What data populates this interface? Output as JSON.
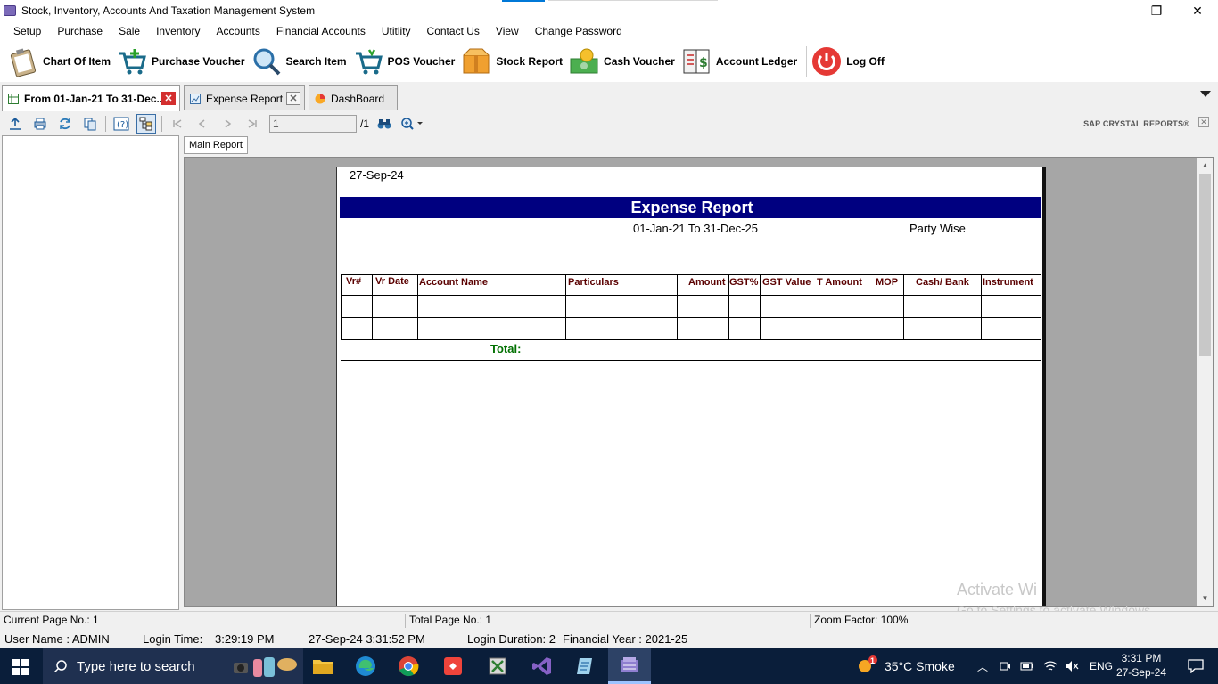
{
  "window": {
    "title": "Stock, Inventory, Accounts And Taxation Management System",
    "controls": {
      "minimize": "—",
      "restore": "❐",
      "close": "✕"
    }
  },
  "menu": [
    "Setup",
    "Purchase",
    "Sale",
    "Inventory",
    "Accounts",
    "Financial Accounts",
    "Utitlity",
    "Contact Us",
    "View",
    "Change Password"
  ],
  "toolbar": {
    "chart_of_item": "Chart Of Item",
    "purchase_voucher": "Purchase Voucher",
    "search_item": "Search Item",
    "pos_voucher": "POS Voucher",
    "stock_report": "Stock Report",
    "cash_voucher": "Cash Voucher",
    "account_ledger": "Account Ledger",
    "log_off": "Log Off"
  },
  "tabs": [
    {
      "label": "From 01-Jan-21 To 31-Dec...",
      "active": true,
      "close": "✕"
    },
    {
      "label": "Expense Report",
      "active": false,
      "close": "✕"
    },
    {
      "label": "DashBoard",
      "active": false
    }
  ],
  "viewer": {
    "page_value": "1",
    "page_total": "/1",
    "brand": "SAP CRYSTAL REPORTS®",
    "main_report_tab": "Main Report"
  },
  "report": {
    "date": "27-Sep-24",
    "title": "Expense Report",
    "range": "01-Jan-21 To 31-Dec-25",
    "grouping": "Party Wise",
    "columns": [
      "Vr#",
      "Vr Date",
      "Account Name",
      "Particulars",
      "Amount",
      "GST%",
      "GST Value",
      "T Amount",
      "MOP",
      "Cash/ Bank",
      "Instrument"
    ],
    "total_label": "Total:",
    "header_color": "#000080",
    "column_header_color": "#5a0000",
    "total_color": "#007000"
  },
  "watermark": {
    "line1": "Activate Wi",
    "line2": "Go to Settings to activate Windows."
  },
  "status": {
    "current_page": "Current Page No.: 1",
    "total_page": "Total Page No.: 1",
    "zoom": "Zoom Factor: 100%"
  },
  "session": {
    "user": "User Name : ADMIN",
    "login_time_label": "Login Time:",
    "login_time": "3:29:19 PM",
    "datetime": "27-Sep-24 3:31:52 PM",
    "login_duration": "Login Duration: 2",
    "financial_year": "Financial Year : 2021-25"
  },
  "taskbar": {
    "search_placeholder": "Type here to search",
    "weather": "35°C  Smoke",
    "weather_badge": "1",
    "language": "ENG",
    "time": "3:31 PM",
    "date": "27-Sep-24"
  }
}
